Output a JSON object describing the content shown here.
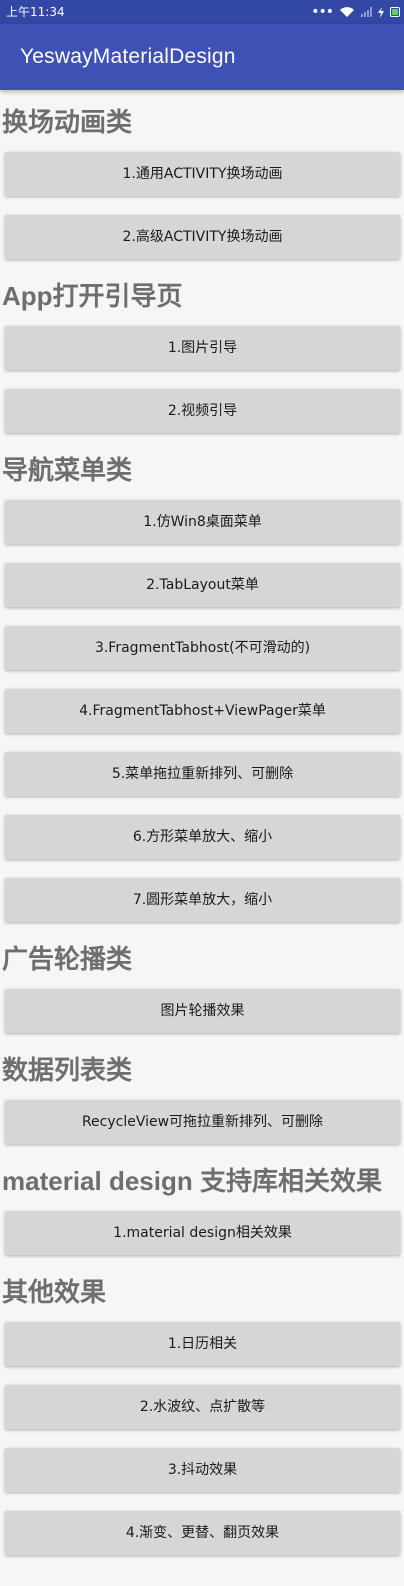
{
  "status_bar": {
    "time": "上午11:34",
    "dots": "•••"
  },
  "toolbar": {
    "title": "YeswayMaterialDesign"
  },
  "sections": [
    {
      "title": "换场动画类",
      "buttons": [
        "1.通用ACTIVITY换场动画",
        "2.高级ACTIVITY换场动画"
      ]
    },
    {
      "title": "App打开引导页",
      "buttons": [
        "1.图片引导",
        "2.视频引导"
      ]
    },
    {
      "title": "导航菜单类",
      "buttons": [
        "1.仿Win8桌面菜单",
        "2.TabLayout菜单",
        "3.FragmentTabhost(不可滑动的)",
        "4.FragmentTabhost+ViewPager菜单",
        "5.菜单拖拉重新排列、可删除",
        "6.方形菜单放大、缩小",
        "7.圆形菜单放大，缩小"
      ]
    },
    {
      "title": "广告轮播类",
      "buttons": [
        "图片轮播效果"
      ]
    },
    {
      "title": "数据列表类",
      "buttons": [
        "RecycleView可拖拉重新排列、可删除"
      ]
    },
    {
      "title": "material design 支持库相关效果",
      "buttons": [
        "1.material design相关效果"
      ]
    },
    {
      "title": "其他效果",
      "buttons": [
        "1.日历相关",
        "2.水波纹、点扩散等",
        "3.抖动效果",
        "4.渐变、更替、翻页效果"
      ]
    }
  ]
}
